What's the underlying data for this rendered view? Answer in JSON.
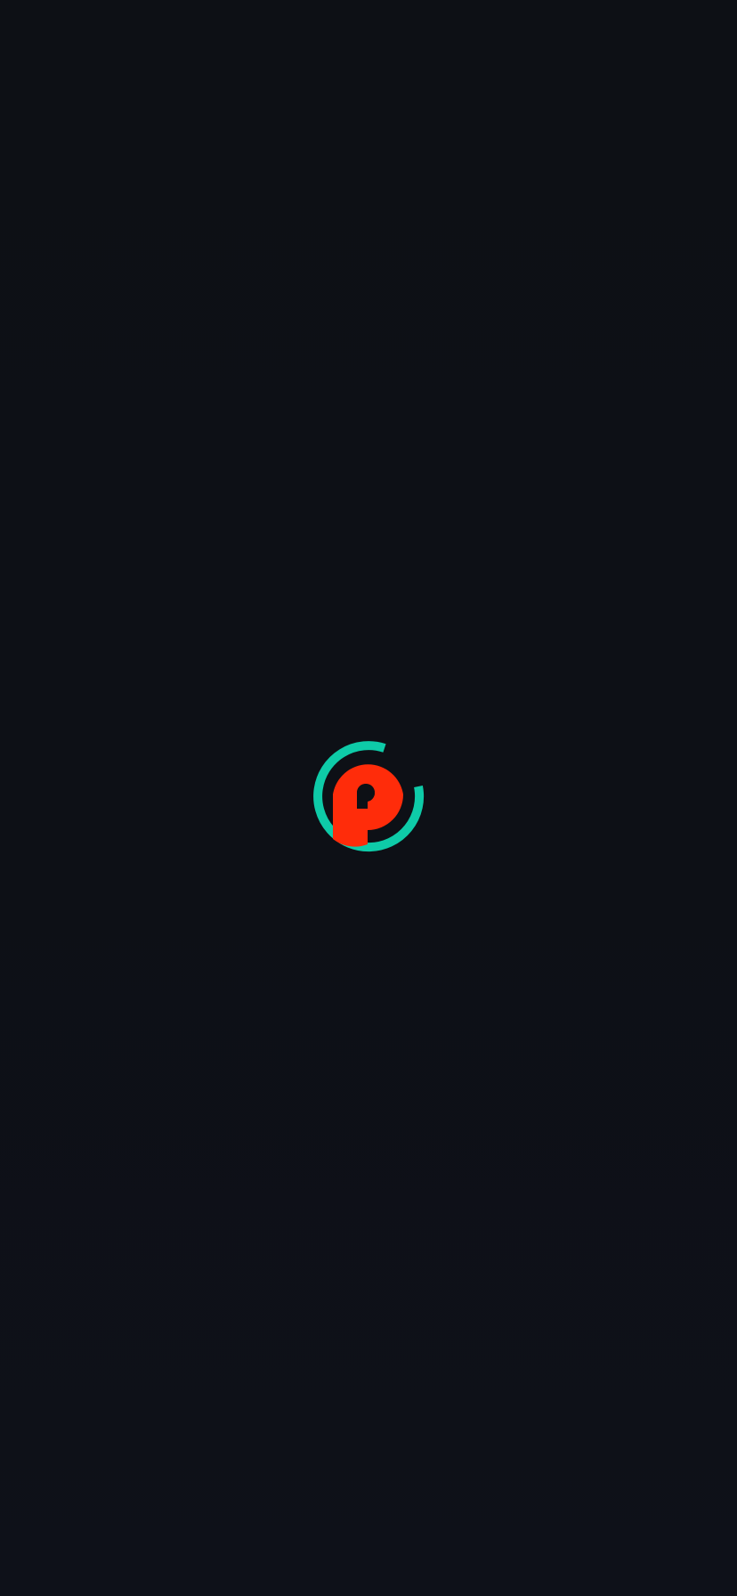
{
  "screen": {
    "name": "splash-screen",
    "background_color": "#0d1015"
  },
  "logo": {
    "icon": "p-circle-logo-icon",
    "ring_color": "#0ecba8",
    "letter_color": "#ff2c0a"
  }
}
